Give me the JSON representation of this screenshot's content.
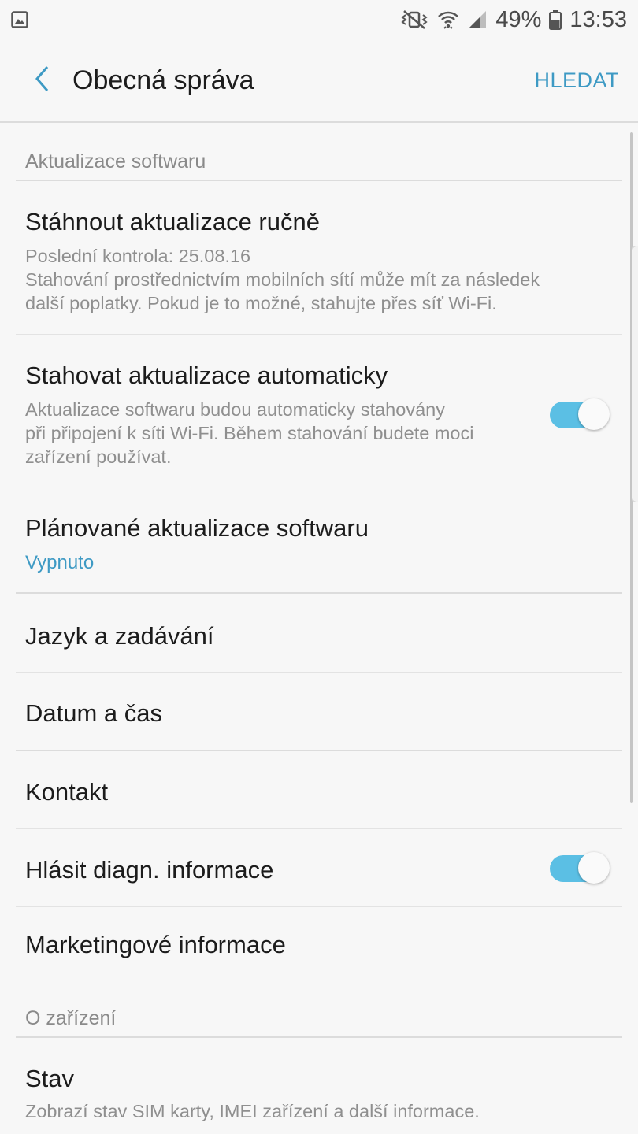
{
  "status_bar": {
    "battery": "49%",
    "time": "13:53",
    "icons": [
      "gallery-icon",
      "mute-vibrate-icon",
      "wifi-icon",
      "signal-icon",
      "battery-icon"
    ]
  },
  "header": {
    "title": "Obecná správa",
    "search_label": "HLEDAT"
  },
  "sections": {
    "software": {
      "header": "Aktualizace softwaru"
    },
    "device": {
      "header": "O zařízení"
    }
  },
  "items": {
    "manual_update": {
      "title": "Stáhnout aktualizace ručně",
      "sub1": "Poslední kontrola: 25.08.16",
      "sub2": "Stahování prostřednictvím mobilních sítí může mít za následek",
      "sub3": "další poplatky. Pokud je to možné, stahujte přes síť Wi-Fi."
    },
    "auto_update": {
      "title": "Stahovat aktualizace automaticky",
      "sub1": "Aktualizace softwaru budou automaticky stahovány",
      "sub2": "při připojení k síti Wi-Fi. Během stahování budete moci",
      "sub3": "zařízení používat.",
      "enabled": true
    },
    "scheduled_update": {
      "title": "Plánované aktualizace softwaru",
      "value": "Vypnuto"
    },
    "language": {
      "title": "Jazyk a zadávání"
    },
    "datetime": {
      "title": "Datum a čas"
    },
    "contact": {
      "title": "Kontakt"
    },
    "diagnostics": {
      "title": "Hlásit diagn. informace",
      "enabled": true
    },
    "marketing": {
      "title": "Marketingové informace"
    },
    "status": {
      "title": "Stav",
      "sub1": "Zobrazí stav SIM karty, IMEI zařízení a další informace."
    }
  },
  "colors": {
    "accent": "#3e9ac4",
    "toggle_on": "#5bbfe4",
    "background": "#f7f7f7"
  }
}
